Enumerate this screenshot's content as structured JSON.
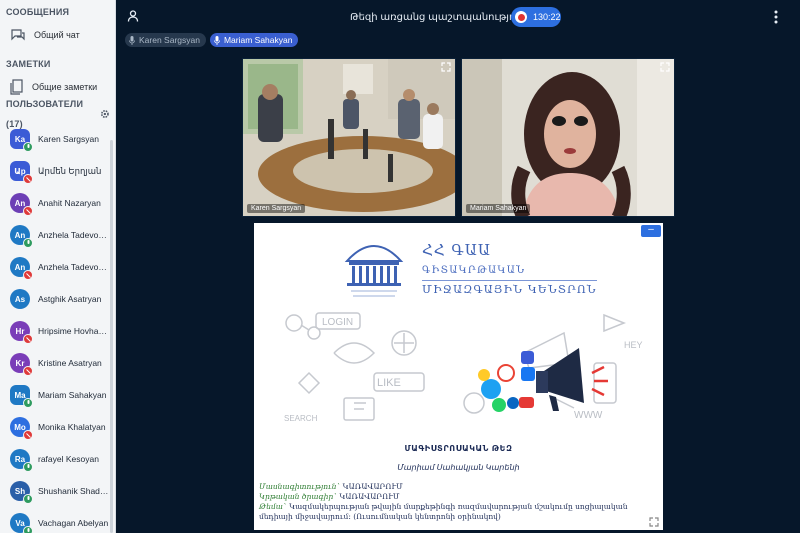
{
  "sidebar": {
    "messages_title": "СООБЩЕНИЯ",
    "public_chat": "Общий чат",
    "notes_title": "ЗАМЕТКИ",
    "shared_notes": "Общие заметки",
    "users_title": "ПОЛЬЗОВАТЕЛИ (17)",
    "users": [
      {
        "initials": "Ka",
        "name": "Karen Sargsyan",
        "color": "#3b5bd6",
        "shape": "square",
        "status": "mic"
      },
      {
        "initials": "Աp",
        "name": "Արմեն Երղյան",
        "color": "#3b5bd6",
        "shape": "square",
        "status": "muted"
      },
      {
        "initials": "An",
        "name": "Anahit Nazaryan",
        "color": "#6c3fb5",
        "shape": "round",
        "status": "muted"
      },
      {
        "initials": "An",
        "name": "Anzhela Tadevosyan",
        "color": "#1f79c4",
        "shape": "round",
        "status": "mic"
      },
      {
        "initials": "An",
        "name": "Anzhela Tadevosyan",
        "color": "#1f79c4",
        "shape": "round",
        "status": "muted"
      },
      {
        "initials": "As",
        "name": "Astghik Asatryan",
        "color": "#1f79c4",
        "shape": "round",
        "status": "none"
      },
      {
        "initials": "Hr",
        "name": "Hripsime Hovhanni...",
        "color": "#7a3db8",
        "shape": "round",
        "status": "muted"
      },
      {
        "initials": "Kr",
        "name": "Kristine Asatryan",
        "color": "#7a3db8",
        "shape": "round",
        "status": "muted"
      },
      {
        "initials": "Ma",
        "name": "Mariam Sahakyan",
        "color": "#1f79c4",
        "shape": "square",
        "status": "mic"
      },
      {
        "initials": "Mo",
        "name": "Monika Khalatyan",
        "color": "#2d6fe0",
        "shape": "round",
        "status": "muted"
      },
      {
        "initials": "Ra",
        "name": "rafayel Kesoyan",
        "color": "#1f79c4",
        "shape": "round",
        "status": "mic"
      },
      {
        "initials": "Sh",
        "name": "Shushanik Shadoyan",
        "color": "#2a5fa8",
        "shape": "round",
        "status": "mic"
      },
      {
        "initials": "Va",
        "name": "Vachagan Abelyan",
        "color": "#1f79c4",
        "shape": "round",
        "status": "mic"
      }
    ]
  },
  "topbar": {
    "title": "Թեզի առցանց պաշտպանություն",
    "record_time": "130:22"
  },
  "talkers": [
    "Karen Sargsyan",
    "Mariam Sahakyan"
  ],
  "videos": [
    {
      "label": "Karen Sargsyan"
    },
    {
      "label": "Mariam Sahakyan"
    }
  ],
  "slide": {
    "heading1": "ՀՀ ԳԱԱ",
    "heading2": "ԳԻՏԱԿՐԹԱԿԱՆ",
    "heading3": "ՄԻՋԱԶԳԱՅԻՆ ԿԵՆՏՐՈՆ",
    "logo_sub": "ԳԻՏԱԿՐԹԱԿԱՆ ՄԻՋԱԶԳԱՅԻՆ ԿԵՆՏՐՈՆ",
    "words": [
      "LOGIN",
      "LIKE",
      "SEARCH",
      "WWW",
      "HEY"
    ],
    "thesis_title": "ՄԱԳԻՍՏՐՈՍԱԿԱՆ ԹԵԶ",
    "author": "Մարիամ Սահակյան Կարենի",
    "meta": [
      {
        "key": "Մասնագիտություն`",
        "value": "ԿԱՌԱՎԱՐՈՒՄ"
      },
      {
        "key": "Կրթական ծրագիր`",
        "value": "ԿԱՌԱՎԱՐՈՒՄ"
      },
      {
        "key": "Թեմա`",
        "value": "Կազմակերպության թվային մարքեթինգի ռազմավարության մշակումը սոցիալական մեդիայի միջավայրում: (Ուսումնական կենտրոնի օրինակով)"
      }
    ]
  }
}
